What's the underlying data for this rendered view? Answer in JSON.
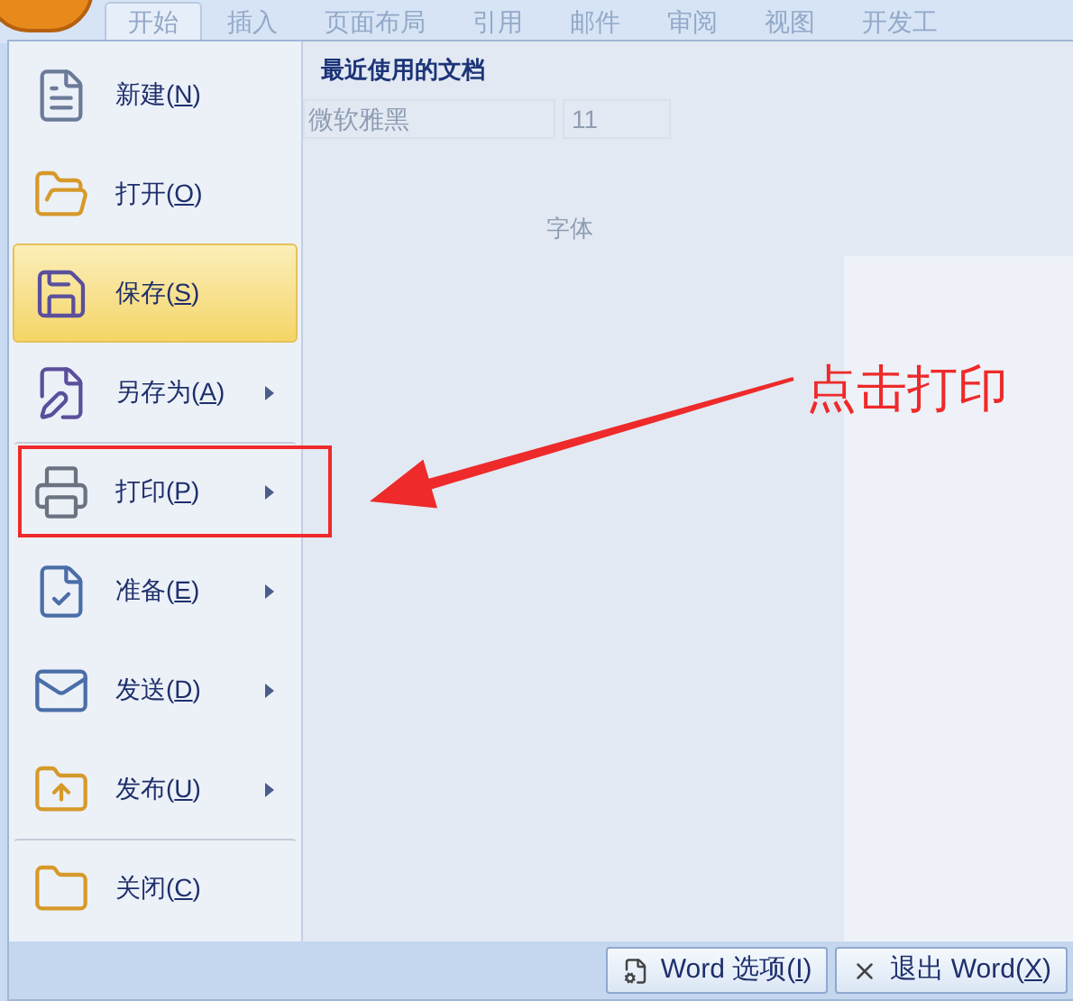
{
  "ribbon_tabs": [
    {
      "label": "开始",
      "selected": true
    },
    {
      "label": "插入",
      "selected": false
    },
    {
      "label": "页面布局",
      "selected": false
    },
    {
      "label": "引用",
      "selected": false
    },
    {
      "label": "邮件",
      "selected": false
    },
    {
      "label": "审阅",
      "selected": false
    },
    {
      "label": "视图",
      "selected": false
    },
    {
      "label": "开发工",
      "selected": false
    }
  ],
  "ribbon_behind": {
    "font_name": "微软雅黑",
    "font_size": "11",
    "group_label": "字体"
  },
  "menu": {
    "items": [
      {
        "before": "新建(",
        "key": "N",
        "after": ")",
        "has_submenu": false,
        "selected": false,
        "divider_before": false
      },
      {
        "before": "打开(",
        "key": "O",
        "after": ")",
        "has_submenu": false,
        "selected": false,
        "divider_before": false
      },
      {
        "before": "保存(",
        "key": "S",
        "after": ")",
        "has_submenu": false,
        "selected": true,
        "divider_before": false
      },
      {
        "before": "另存为(",
        "key": "A",
        "after": ")",
        "has_submenu": true,
        "selected": false,
        "divider_before": false
      },
      {
        "before": "打印(",
        "key": "P",
        "after": ")",
        "has_submenu": true,
        "selected": false,
        "divider_before": true
      },
      {
        "before": "准备(",
        "key": "E",
        "after": ")",
        "has_submenu": true,
        "selected": false,
        "divider_before": false
      },
      {
        "before": "发送(",
        "key": "D",
        "after": ")",
        "has_submenu": true,
        "selected": false,
        "divider_before": false
      },
      {
        "before": "发布(",
        "key": "U",
        "after": ")",
        "has_submenu": true,
        "selected": false,
        "divider_before": false
      },
      {
        "before": "关闭(",
        "key": "C",
        "after": ")",
        "has_submenu": false,
        "selected": false,
        "divider_before": true
      }
    ],
    "recent_title": "最近使用的文档",
    "footer_buttons": [
      {
        "kind": "options",
        "before": "Word 选项(",
        "key": "I",
        "after": ")"
      },
      {
        "kind": "exit",
        "before": "退出 Word(",
        "key": "X",
        "after": ")"
      }
    ]
  },
  "annotation": {
    "text": "点击打印"
  }
}
